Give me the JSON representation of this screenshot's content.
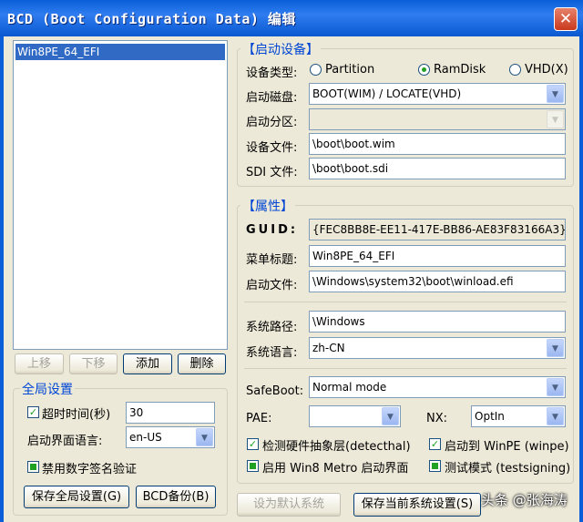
{
  "window": {
    "title": "BCD (Boot Configuration Data) 编辑",
    "close_symbol": "✕"
  },
  "boot_list": {
    "items": [
      "Win8PE_64_EFI"
    ]
  },
  "list_buttons": {
    "up": "上移",
    "down": "下移",
    "add": "添加",
    "delete": "删除"
  },
  "global_settings": {
    "legend": "全局设置",
    "timeout_label": "超时时间(秒)",
    "timeout_checked": true,
    "timeout_value": "30",
    "boot_ui_lang_label": "启动界面语言:",
    "boot_ui_lang_value": "en-US",
    "disable_sig_label": "禁用数字签名验证",
    "save_global": "保存全局设置(G)",
    "bcd_backup": "BCD备份(B)"
  },
  "boot_device": {
    "legend": "【启动设备】",
    "device_type_label": "设备类型:",
    "device_type_options": [
      "Partition",
      "RamDisk",
      "VHD(X)"
    ],
    "device_type_selected": "RamDisk",
    "boot_disk_label": "启动磁盘:",
    "boot_disk_value": "BOOT(WIM) / LOCATE(VHD)",
    "boot_partition_label": "启动分区:",
    "boot_partition_value": "",
    "device_file_label": "设备文件:",
    "device_file_value": "\\boot\\boot.wim",
    "sdi_file_label": "SDI 文件:",
    "sdi_file_value": "\\boot\\boot.sdi"
  },
  "properties": {
    "legend": "【属性】",
    "guid_label": "GUID:",
    "guid_value": "{FEC8BB8E-EE11-417E-BB86-AE83F83166A3}",
    "menu_title_label": "菜单标题:",
    "menu_title_value": "Win8PE_64_EFI",
    "boot_file_label": "启动文件:",
    "boot_file_value": "\\Windows\\system32\\boot\\winload.efi",
    "system_path_label": "系统路径:",
    "system_path_value": "\\Windows",
    "system_lang_label": "系统语言:",
    "system_lang_value": "zh-CN",
    "safeboot_label": "SafeBoot:",
    "safeboot_value": "Normal mode",
    "pae_label": "PAE:",
    "pae_value": "",
    "nx_label": "NX:",
    "nx_value": "OptIn",
    "detect_hal_label": "检测硬件抽象层(detecthal)",
    "detect_hal_checked": true,
    "boot_winpe_label": "启动到 WinPE (winpe)",
    "boot_winpe_checked": true,
    "metro_label": "启用 Win8 Metro 启动界面",
    "test_mode_label": "测试模式 (testsigning)"
  },
  "bottom_buttons": {
    "set_default": "设为默认系统",
    "save_current": "保存当前系统设置(S)"
  },
  "watermark": "头条 @张海涛",
  "colors": {
    "title_bar": "#0a5fd8",
    "selection": "#316ac5",
    "check_green": "#21a121",
    "legend_blue": "#0046d5"
  }
}
